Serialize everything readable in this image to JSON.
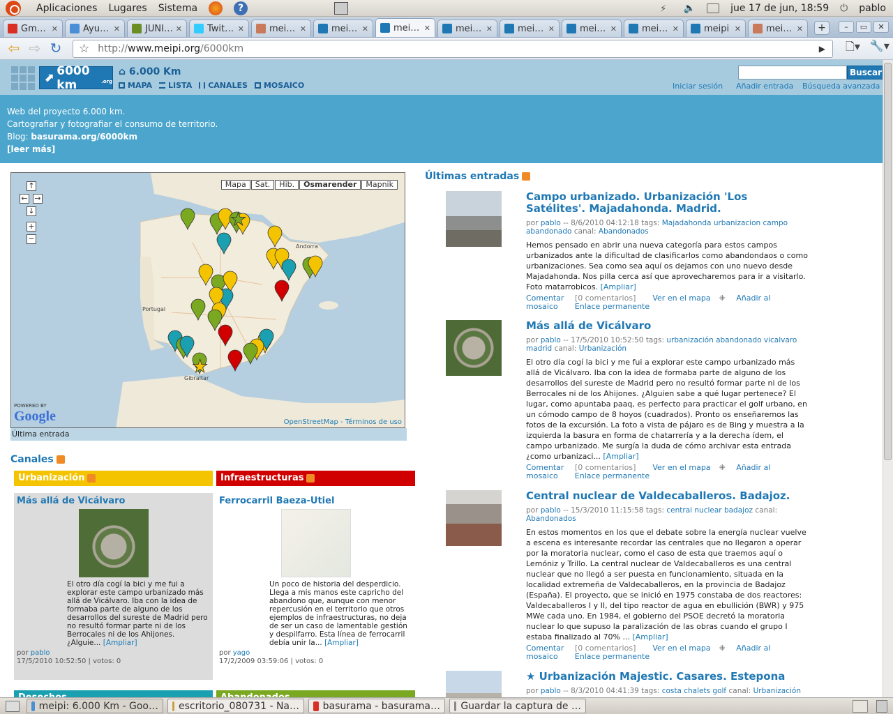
{
  "system": {
    "menus": [
      "Aplicaciones",
      "Lugares",
      "Sistema"
    ],
    "clock": "jue 17 de jun, 18:59",
    "user": "pablo"
  },
  "tabs": [
    {
      "label": "Gm…",
      "color": "#d93025"
    },
    {
      "label": "Ayu…",
      "color": "#4a8fd6"
    },
    {
      "label": "JUNI…",
      "color": "#6b8e23"
    },
    {
      "label": "Twit…",
      "color": "#33ccff"
    },
    {
      "label": "mei…",
      "color": "#c97a5c"
    },
    {
      "label": "mei…",
      "color": "#1f78b4"
    },
    {
      "label": "mei…",
      "color": "#1f78b4",
      "active": true
    },
    {
      "label": "mei…",
      "color": "#1f78b4"
    },
    {
      "label": "mei…",
      "color": "#1f78b4"
    },
    {
      "label": "mei…",
      "color": "#1f78b4"
    },
    {
      "label": "mei…",
      "color": "#1f78b4"
    },
    {
      "label": "meipi",
      "color": "#1f78b4"
    },
    {
      "label": "mei…",
      "color": "#c97a5c"
    }
  ],
  "browser": {
    "url_scheme": "http://",
    "url_host": "www.meipi.org",
    "url_path": "/6000km"
  },
  "site": {
    "logo": "6000 km",
    "logo_sub": ".org",
    "name": "⌂ 6.000 Km",
    "nav": [
      "MAPA",
      "LISTA",
      "CANALES",
      "MOSAICO"
    ],
    "search_button": "Buscar",
    "search_value": "",
    "links": [
      "Iniciar sesión",
      "Añadir entrada",
      "Búsqueda avanzada"
    ],
    "intro": [
      "Web del proyecto 6.000 km.",
      "Cartografiar y fotografiar el consumo de territorio.",
      "Blog: ",
      "basurama.org/6000km",
      "[leer más]"
    ]
  },
  "map": {
    "types": [
      "Mapa",
      "Sat.",
      "Hib.",
      "Osmarender",
      "Mapnik"
    ],
    "selected": "Osmarender",
    "controls": [
      "↑",
      "←",
      "→",
      "↓",
      "+",
      "−"
    ],
    "labels": [
      "Portugal",
      "Andorra",
      "Gibraltar"
    ],
    "powered": "POWERED BY",
    "google": "Google",
    "attribution": "OpenStreetMap - Términos de uso",
    "caption": "Última entrada"
  },
  "channels": {
    "heading": "Canales",
    "items": [
      {
        "name": "Urbanización",
        "color": "#f5c400",
        "bg": "#dcdcdc",
        "post_title": "Más allá de Vicálvaro",
        "text": "El otro día cogí la bici y me fui a explorar este campo urbanizado más allá de Vicálvaro. Iba con la idea de formaba parte de alguno de los desarrollos del sureste de Madrid pero no resultó formar parte ni de los Berrocales ni de los Ahijones. ¿Alguie...",
        "more": "[Ampliar]",
        "author": "pablo",
        "meta": "17/5/2010 10:52:50 | votos: 0"
      },
      {
        "name": "Infraestructuras",
        "color": "#d10000",
        "bg": "#ffffff",
        "post_title": "Ferrocarril Baeza-Utiel",
        "text": "Un poco de historia del desperdicio. Llega a mis manos este capricho del abandono que, aunque con menor repercusión en el territorio que otros ejemplos de infraestructuras, no deja de ser un caso de lamentable gestión y despilfarro. Esta línea de ferrocarril debía unir la...",
        "more": "[Ampliar]",
        "author": "yago",
        "meta": "17/2/2009 03:59:06 | votos: 0"
      }
    ],
    "more": [
      {
        "name": "Desechos",
        "color": "#1aa0b0"
      },
      {
        "name": "Abandonados",
        "color": "#7aa820"
      }
    ]
  },
  "entries": {
    "heading": "Últimas entradas",
    "items": [
      {
        "title": "Campo urbanizado. Urbanización 'Los Satélites'. Majadahonda. Madrid.",
        "author": "pablo",
        "date": "8/6/2010 04:12:18",
        "tags": "Majadahonda urbanizacion campo abandonado",
        "channel": "Abandonados",
        "text": "Hemos pensado en abrir una nueva categoría para estos campos urbanizados ante la dificultad de clasificarlos como abandondaos o como urbanizaciones. Sea como sea aquí os dejamos con uno nuevo desde Majadahonda. Nos pilla cerca así que aprovecharemos para ir a visitarlo. Foto matarrobicos.",
        "more": "[Ampliar]"
      },
      {
        "title": "Más allá de Vicálvaro",
        "author": "pablo",
        "date": "17/5/2010 10:52:50",
        "tags": "urbanización abandonado vicalvaro madrid",
        "channel": "Urbanización",
        "text": "El otro día cogí la bici y me fui a explorar este campo urbanizado más allá de Vicálvaro. Iba con la idea de formaba parte de alguno de los desarrollos del sureste de Madrid pero no resultó formar parte ni de los Berrocales ni de los Ahijones. ¿Alguien sabe a qué lugar pertenece? El lugar, como apuntaba paaq, es perfecto para practicar el golf urbano, en un cómodo campo de 8 hoyos (cuadrados). Pronto os enseñaremos las fotos de la excursión. La foto a vista de pájaro es de Bing y muestra a la izquierda la basura en forma de chatarrería y a la derecha ídem, el campo urbanizado. Me surgía la duda de cómo archivar esta entrada ¿como urbanizaci...",
        "more": "[Ampliar]"
      },
      {
        "title": "Central nuclear de Valdecaballeros. Badajoz.",
        "author": "pablo",
        "date": "15/3/2010 11:15:58",
        "tags": "central nuclear badajoz",
        "channel": "Abandonados",
        "text": "En estos momentos en los que el debate sobre la energía nuclear vuelve a escena es interesante recordar las centrales que no llegaron a operar por la moratoria nuclear, como el caso de esta que traemos aquí o Lemóniz y Trillo. La central nuclear de Valdecaballeros es una central nuclear que no llegó a ser puesta en funcionamiento, situada en la localidad extremeña de Valdecaballeros, en la provincia de Badajoz (España). El proyecto, que se inició en 1975 constaba de dos reactores: Valdecaballeros I y II, del tipo reactor de agua en ebullición (BWR) y 975 MWe cada uno. En 1984, el gobierno del PSOE decretó la moratoria nuclear lo que supuso la paralización de las obras cuando el grupo I estaba finalizado al 70% ...",
        "more": "[Ampliar]"
      },
      {
        "title": "★ Urbanización Majestic. Casares. Estepona",
        "author": "pablo",
        "date": "8/3/2010 04:41:39",
        "tags": "costa chalets golf",
        "channel": "Urbanización",
        "text": "",
        "more": ""
      }
    ],
    "labels": {
      "by": "por",
      "tags": "tags:",
      "channel": "canal:",
      "comment": "Comentar",
      "comments": "[0 comentarios]",
      "map": "Ver en el mapa",
      "mosaic": "Añadir al mosaico",
      "permalink": "Enlace permanente"
    }
  },
  "taskbar": [
    {
      "label": "meipi: 6.000 Km - Goo…",
      "color": "#4a8fd6",
      "active": true
    },
    {
      "label": "escritorio_080731 - Na…",
      "color": "#c8a040"
    },
    {
      "label": "basurama - basurama…",
      "color": "#d93025"
    },
    {
      "label": "Guardar la captura de …",
      "color": "#888888"
    }
  ]
}
